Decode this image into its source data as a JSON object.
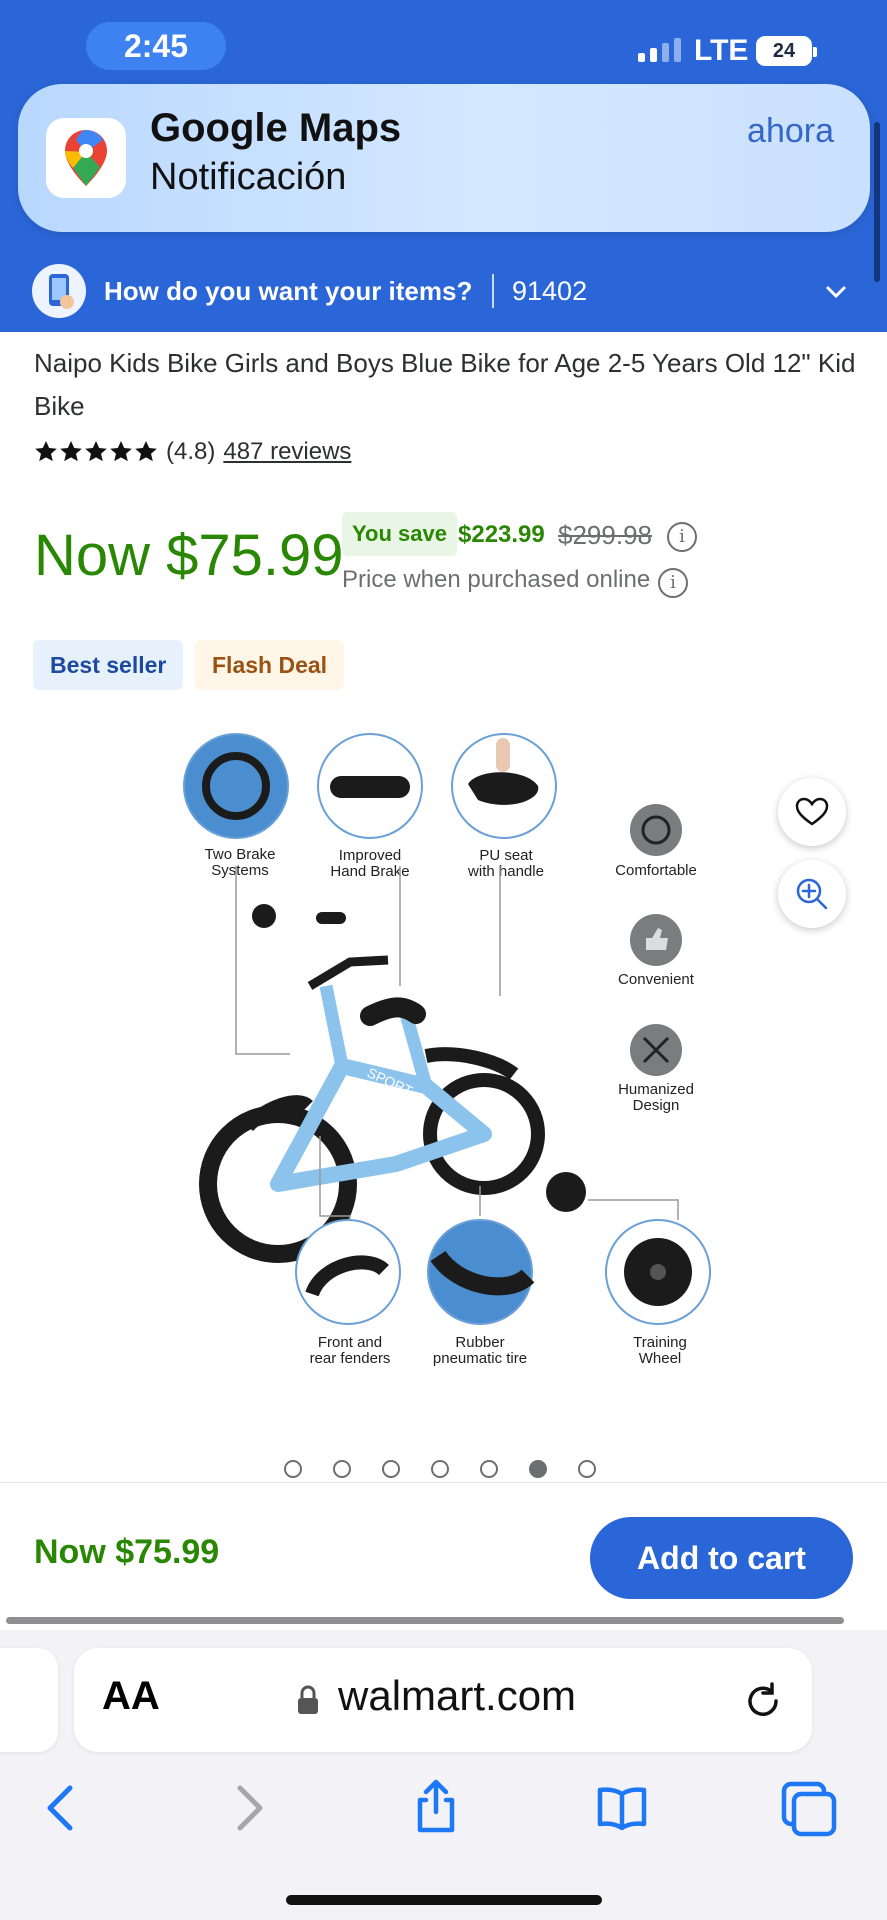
{
  "status_bar": {
    "time": "2:45",
    "network": "LTE",
    "battery": "24"
  },
  "notification": {
    "app": "Google Maps",
    "message": "Notificación",
    "time": "ahora"
  },
  "delivery": {
    "question": "How do you want your items?",
    "zip": "91402"
  },
  "product": {
    "title": "Naipo Kids Bike Girls and Boys Blue Bike for Age 2-5 Years Old 12\" Kid Bike",
    "rating": "(4.8)",
    "rating_value": 4.8,
    "reviews": "487 reviews",
    "price": "Now $75.99",
    "you_save_label": "You save",
    "you_save_amount": "$223.99",
    "was_price": "$299.98",
    "price_note": "Price when purchased online",
    "badges": [
      "Best seller",
      "Flash Deal"
    ]
  },
  "image_labels": {
    "brake": "Two Brake\nSystems",
    "hand_brake": "Improved\nHand Brake",
    "seat": "PU seat\nwith handle",
    "comfortable": "Comfortable",
    "convenient": "Convenient",
    "humanized": "Humanized\nDesign",
    "fenders": "Front and\nrear fenders",
    "tire": "Rubber\npneumatic tire",
    "wheel": "Training\nWheel",
    "frame_text": "SPORT"
  },
  "carousel": {
    "count": 7,
    "active_index": 5
  },
  "bottom_bar": {
    "price": "Now $75.99",
    "button": "Add to cart"
  },
  "browser": {
    "text_size": "AA",
    "url": "walmart.com"
  },
  "colors": {
    "primary": "#2a66d7",
    "price_green": "#2a8703",
    "badge_blue": "#e6f1fc",
    "badge_orange": "#fff6e8",
    "ios_blue": "#1e78f5"
  }
}
